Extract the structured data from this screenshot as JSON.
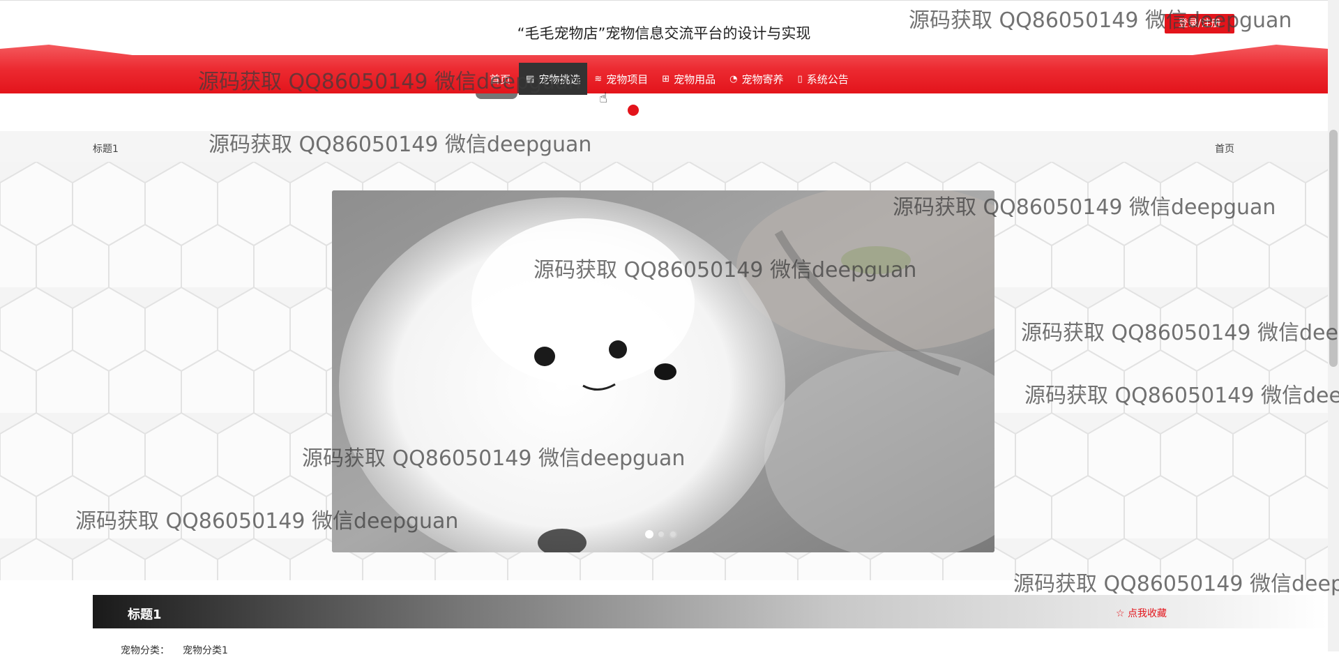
{
  "header": {
    "site_title": "“毛毛宠物店”宠物信息交流平台的设计与实现",
    "login_label": "登录/注册"
  },
  "nav": {
    "home_label": "首页",
    "items": [
      {
        "label": "宠物挑选",
        "icon": "grid-icon"
      },
      {
        "label": "宠物项目",
        "icon": "sliders-icon"
      },
      {
        "label": "宠物用品",
        "icon": "book-icon"
      },
      {
        "label": "宠物寄养",
        "icon": "dashboard-icon"
      },
      {
        "label": "系统公告",
        "icon": "notice-icon"
      }
    ],
    "active_index": 0
  },
  "breadcrumb": {
    "title": "标题1",
    "home": "首页"
  },
  "carousel": {
    "slide_count": 3,
    "active_index": 0
  },
  "detail": {
    "title": "标题1",
    "favorite_label": "点我收藏",
    "category_label": "宠物分类：",
    "category_value": "宠物分类1"
  },
  "watermark": "源码获取 QQ86050149 微信deepguan",
  "colors": {
    "accent_red": "#e3141b",
    "nav_active": "#333333"
  }
}
